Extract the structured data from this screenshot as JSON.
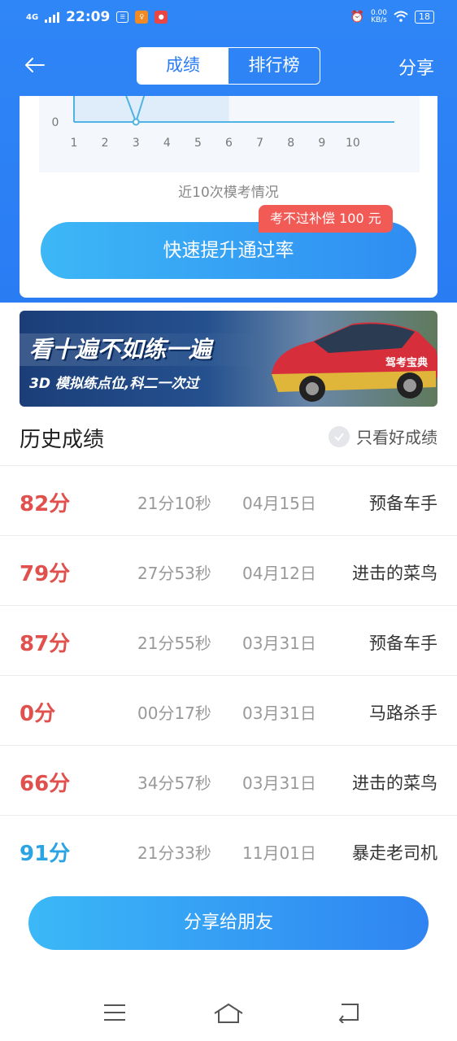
{
  "status": {
    "network": "4G",
    "time": "22:09",
    "speed": "0.00",
    "speed_unit": "KB/s",
    "battery": "18"
  },
  "nav": {
    "tab_active": "成绩",
    "tab_other": "排行榜",
    "share": "分享"
  },
  "chart_data": {
    "type": "line",
    "x": [
      1,
      2,
      3,
      4,
      5,
      6,
      7,
      8,
      9,
      10
    ],
    "xtick_labels": [
      "1",
      "2",
      "3",
      "4",
      "5",
      "6",
      "7",
      "8",
      "9",
      "10"
    ],
    "visible_ytick": "0",
    "point": {
      "x": 3,
      "y": 0
    },
    "caption": "近10次模考情况"
  },
  "card": {
    "boost_label": "快速提升通过率",
    "badge": "考不过补偿 100 元"
  },
  "banner": {
    "headline": "看十遍不如练一遍",
    "subline": "3D 模拟练点位,科二一次过",
    "car_text": "驾考宝典"
  },
  "history": {
    "title": "历史成绩",
    "filter_label": "只看好成绩",
    "rows": [
      {
        "score": "82分",
        "duration": "21分10秒",
        "date": "04月15日",
        "title": "预备车手",
        "color": "#e0514d"
      },
      {
        "score": "79分",
        "duration": "27分53秒",
        "date": "04月12日",
        "title": "进击的菜鸟",
        "color": "#e0514d"
      },
      {
        "score": "87分",
        "duration": "21分55秒",
        "date": "03月31日",
        "title": "预备车手",
        "color": "#e0514d"
      },
      {
        "score": "0分",
        "duration": "00分17秒",
        "date": "03月31日",
        "title": "马路杀手",
        "color": "#e0514d"
      },
      {
        "score": "66分",
        "duration": "34分57秒",
        "date": "03月31日",
        "title": "进击的菜鸟",
        "color": "#e0514d"
      },
      {
        "score": "91分",
        "duration": "21分33秒",
        "date": "11月01日",
        "title": "暴走老司机",
        "color": "#2aa4e3"
      }
    ]
  },
  "share_button": "分享给朋友"
}
